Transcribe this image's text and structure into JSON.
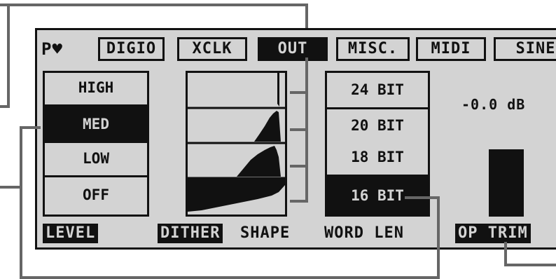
{
  "menu": {
    "logo": "P♥"
  },
  "tabs": [
    {
      "label": "DIGIO",
      "active": false
    },
    {
      "label": "XCLK",
      "active": false
    },
    {
      "label": "OUT",
      "active": true
    },
    {
      "label": "MISC.",
      "active": false
    },
    {
      "label": "MIDI",
      "active": false
    },
    {
      "label": "SINE",
      "active": false
    }
  ],
  "level": {
    "options": [
      "HIGH",
      "MED",
      "LOW",
      "OFF"
    ],
    "selected": "MED",
    "label": "LEVEL"
  },
  "dither": {
    "label_a": "DITHER",
    "label_b": "SHAPE"
  },
  "word_len": {
    "options": [
      "24 BIT",
      "20 BIT",
      "18 BIT",
      "16 BIT"
    ],
    "selected": "16 BIT",
    "label": "WORD LEN"
  },
  "trim": {
    "value": "-0.0 dB",
    "label": "OP TRIM"
  },
  "colors": {
    "lcd_bg": "#d3d3d3",
    "ink": "#111111",
    "callout": "#666666"
  }
}
